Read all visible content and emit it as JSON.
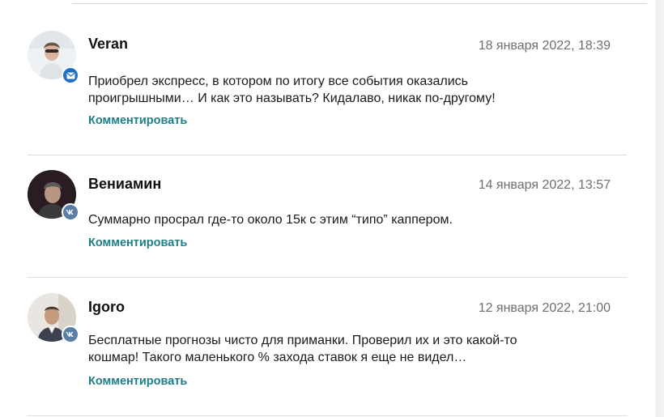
{
  "comments": [
    {
      "author": "Veran",
      "date": "18 января 2022, 18:39",
      "text": "Приобрел экспресс, в котором по итогу все события оказались проигрышными… И как это называть? Кидалаво, никак по-другому!",
      "reply_label": "Комментировать",
      "badge": "mail-icon"
    },
    {
      "author": "Вениамин",
      "date": "14 января 2022, 13:57",
      "text": "Суммарно просрал где-то около 15к с этим “типо” каппером.",
      "reply_label": "Комментировать",
      "badge": "vk-icon"
    },
    {
      "author": "Igoro",
      "date": "12 января 2022, 21:00",
      "text": "Бесплатные прогнозы чисто для приманки. Проверил их и это какой-то кошмар! Такого маленького % захода ставок я еще не видел…",
      "reply_label": "Комментировать",
      "badge": "vk-icon"
    }
  ],
  "colors": {
    "accent": "#1e7f88",
    "date_gray": "#6e6e6e",
    "separator": "#dcdcdc",
    "mail_badge": "#1e6fc8",
    "vk_badge": "#5a7ea6"
  }
}
